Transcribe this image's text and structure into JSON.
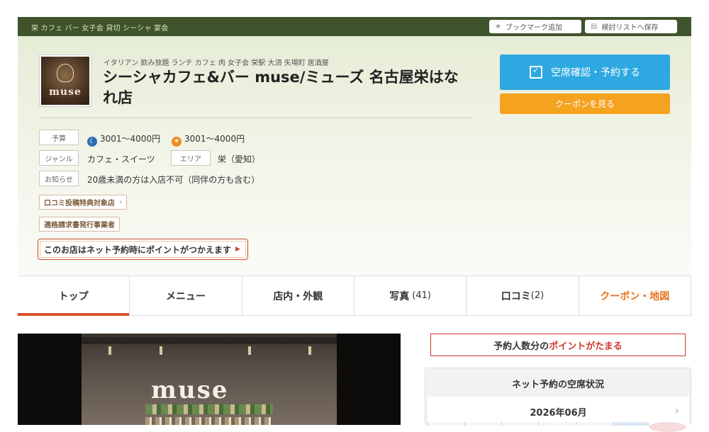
{
  "topbar": {
    "tags": "栄 カフェ バー 女子会 貸切 シーシャ 宴会",
    "bookmark_label": "ブックマーク追加",
    "list_label": "検討リストへ保存"
  },
  "shop": {
    "logo_text": "muse",
    "categories": "イタリアン 飲み放題 ランチ カフェ 肉 女子会 栄駅 大須 矢場町 居酒屋",
    "title": "シーシャカフェ&バー muse/ミューズ 名古屋栄はなれ店"
  },
  "info": {
    "budget_label": "予算",
    "budget_dinner": "3001～4000円",
    "budget_lunch": "3001～4000円",
    "genre_label": "ジャンル",
    "genre_value": "カフェ・スイーツ",
    "area_label": "エリア",
    "area_value": "栄（愛知）",
    "notice_label": "お知らせ",
    "notice_value": "20歳未満の方は入店不可（同伴の方も含む）"
  },
  "badges": {
    "review": "口コミ投稿特典対象店",
    "invoice": "適格請求書発行事業者",
    "points": "このお店はネット予約時にポイントがつかえます"
  },
  "actions": {
    "reserve": "空席確認・予約する",
    "coupon": "クーポンを見る"
  },
  "tabs": {
    "top": "トップ",
    "menu": "メニュー",
    "interior": "店内・外観",
    "photo": "写真",
    "photo_count": "(41)",
    "review": "口コミ",
    "review_count": "(2)",
    "coupon_map": "クーポン・地図"
  },
  "photo_sign": "muse",
  "side": {
    "point_prefix": "予約人数分の",
    "point_highlight": "ポイントがたまる",
    "availability_title": "ネット予約の空席状況",
    "month": "2026年06月"
  },
  "colors": {
    "topbar": "#3f532c",
    "reserve": "#2ea8e0",
    "coupon": "#f5a21f",
    "accent": "#d9532c",
    "coupon_tab": "#e8721c"
  }
}
